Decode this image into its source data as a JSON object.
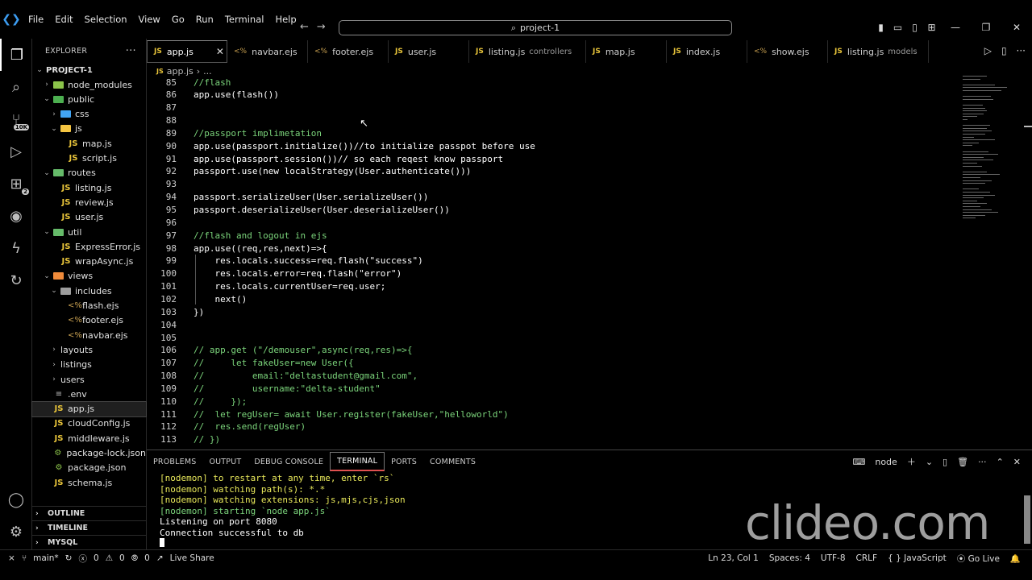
{
  "titlebar": {
    "menu": [
      "File",
      "Edit",
      "Selection",
      "View",
      "Go",
      "Run",
      "Terminal",
      "Help"
    ],
    "search_text": "project-1"
  },
  "activity": {
    "source_control_badge": "10K",
    "extensions_badge": "2"
  },
  "sidebar": {
    "title": "EXPLORER",
    "project": "PROJECT-1",
    "tree": [
      {
        "label": "node_modules",
        "kind": "folder",
        "depth": 1,
        "open": false
      },
      {
        "label": "public",
        "kind": "folder",
        "depth": 1,
        "open": true
      },
      {
        "label": "css",
        "kind": "folder",
        "depth": 2,
        "open": false
      },
      {
        "label": "js",
        "kind": "folder",
        "depth": 2,
        "open": true
      },
      {
        "label": "map.js",
        "kind": "js",
        "depth": 3
      },
      {
        "label": "script.js",
        "kind": "js",
        "depth": 3
      },
      {
        "label": "routes",
        "kind": "folder",
        "depth": 1,
        "open": true
      },
      {
        "label": "listing.js",
        "kind": "js",
        "depth": 2
      },
      {
        "label": "review.js",
        "kind": "js",
        "depth": 2
      },
      {
        "label": "user.js",
        "kind": "js",
        "depth": 2
      },
      {
        "label": "util",
        "kind": "folder",
        "depth": 1,
        "open": true
      },
      {
        "label": "ExpressError.js",
        "kind": "js",
        "depth": 2
      },
      {
        "label": "wrapAsync.js",
        "kind": "js",
        "depth": 2
      },
      {
        "label": "views",
        "kind": "folder",
        "depth": 1,
        "open": true
      },
      {
        "label": "includes",
        "kind": "folder",
        "depth": 2,
        "open": true
      },
      {
        "label": "flash.ejs",
        "kind": "ejs",
        "depth": 3
      },
      {
        "label": "footer.ejs",
        "kind": "ejs",
        "depth": 3
      },
      {
        "label": "navbar.ejs",
        "kind": "ejs",
        "depth": 3
      },
      {
        "label": "layouts",
        "kind": "folder",
        "depth": 2,
        "open": false
      },
      {
        "label": "listings",
        "kind": "folder",
        "depth": 2,
        "open": false
      },
      {
        "label": "users",
        "kind": "folder",
        "depth": 2,
        "open": false
      },
      {
        "label": ".env",
        "kind": "env",
        "depth": 1
      },
      {
        "label": "app.js",
        "kind": "js",
        "depth": 1,
        "selected": true
      },
      {
        "label": "cloudConfig.js",
        "kind": "js",
        "depth": 1
      },
      {
        "label": "middleware.js",
        "kind": "js",
        "depth": 1
      },
      {
        "label": "package-lock.json",
        "kind": "json",
        "depth": 1
      },
      {
        "label": "package.json",
        "kind": "json",
        "depth": 1
      },
      {
        "label": "schema.js",
        "kind": "js",
        "depth": 1
      }
    ],
    "sections": [
      "OUTLINE",
      "TIMELINE",
      "MYSQL"
    ]
  },
  "tabs": [
    {
      "label": "app.js",
      "icon": "JS",
      "active": true
    },
    {
      "label": "navbar.ejs",
      "icon": "<%"
    },
    {
      "label": "footer.ejs",
      "icon": "<%"
    },
    {
      "label": "user.js",
      "icon": "JS"
    },
    {
      "label": "listing.js",
      "icon": "JS",
      "desc": "controllers"
    },
    {
      "label": "map.js",
      "icon": "JS"
    },
    {
      "label": "index.js",
      "icon": "JS"
    },
    {
      "label": "show.ejs",
      "icon": "<%"
    },
    {
      "label": "listing.js",
      "icon": "JS",
      "desc": "models"
    }
  ],
  "breadcrumb": {
    "file": "app.js",
    "rest": "..."
  },
  "code": [
    {
      "n": "85",
      "text": "//flash",
      "type": "comment"
    },
    {
      "n": "86",
      "text": "app.use(flash())",
      "type": "code"
    },
    {
      "n": "87",
      "text": "",
      "type": "code"
    },
    {
      "n": "88",
      "text": "",
      "type": "code"
    },
    {
      "n": "89",
      "text": "//passport implimetation",
      "type": "comment"
    },
    {
      "n": "90",
      "text": "app.use(passport.initialize())//to initialize passpot before use",
      "type": "code"
    },
    {
      "n": "91",
      "text": "app.use(passport.session())// so each reqest know passport",
      "type": "code"
    },
    {
      "n": "92",
      "text": "passport.use(new localStrategy(User.authenticate()))",
      "type": "code"
    },
    {
      "n": "93",
      "text": "",
      "type": "code"
    },
    {
      "n": "94",
      "text": "passport.serializeUser(User.serializeUser())",
      "type": "code"
    },
    {
      "n": "95",
      "text": "passport.deserializeUser(User.deserializeUser())",
      "type": "code"
    },
    {
      "n": "96",
      "text": "",
      "type": "code"
    },
    {
      "n": "97",
      "text": "//flash and logout in ejs",
      "type": "comment"
    },
    {
      "n": "98",
      "text": "app.use((req,res,next)=>{",
      "type": "code"
    },
    {
      "n": "99",
      "text": "    res.locals.success=req.flash(\"success\")",
      "type": "code"
    },
    {
      "n": "100",
      "text": "    res.locals.error=req.flash(\"error\")",
      "type": "code"
    },
    {
      "n": "101",
      "text": "    res.locals.currentUser=req.user;",
      "type": "code"
    },
    {
      "n": "102",
      "text": "    next()",
      "type": "code"
    },
    {
      "n": "103",
      "text": "})",
      "type": "code"
    },
    {
      "n": "104",
      "text": "",
      "type": "code"
    },
    {
      "n": "105",
      "text": "",
      "type": "code"
    },
    {
      "n": "106",
      "text": "// app.get (\"/demouser\",async(req,res)=>{",
      "type": "comment"
    },
    {
      "n": "107",
      "text": "//     let fakeUser=new User({",
      "type": "comment"
    },
    {
      "n": "108",
      "text": "//         email:\"deltastudent@gmail.com\",",
      "type": "comment"
    },
    {
      "n": "109",
      "text": "//         username:\"delta-student\"",
      "type": "comment"
    },
    {
      "n": "110",
      "text": "//     });",
      "type": "comment"
    },
    {
      "n": "111",
      "text": "//  let regUser= await User.register(fakeUser,\"helloworld\")",
      "type": "comment"
    },
    {
      "n": "112",
      "text": "//  res.send(regUser)",
      "type": "comment"
    },
    {
      "n": "113",
      "text": "// })",
      "type": "comment"
    }
  ],
  "panel": {
    "tabs": [
      "PROBLEMS",
      "OUTPUT",
      "DEBUG CONSOLE",
      "TERMINAL",
      "PORTS",
      "COMMENTS"
    ],
    "active_tab": "TERMINAL",
    "shell": "node",
    "terminal": [
      {
        "text": "[nodemon] to restart at any time, enter `rs`",
        "color": "yellow"
      },
      {
        "text": "[nodemon] watching path(s): *.*",
        "color": "yellow"
      },
      {
        "text": "[nodemon] watching extensions: js,mjs,cjs,json",
        "color": "yellow"
      },
      {
        "text": "[nodemon] starting `node app.js`",
        "color": "green"
      },
      {
        "text": "Listening on port 8080",
        "color": "white"
      },
      {
        "text": "Connection successful to db",
        "color": "white"
      }
    ],
    "watermark": "clideo.com"
  },
  "status": {
    "branch": "main*",
    "errors": "0",
    "warnings": "0",
    "ports": "0",
    "live_share": "Live Share",
    "position": "Ln 23, Col 1",
    "spaces": "Spaces: 4",
    "encoding": "UTF-8",
    "eol": "CRLF",
    "language": "JavaScript",
    "go_live": "Go Live"
  }
}
